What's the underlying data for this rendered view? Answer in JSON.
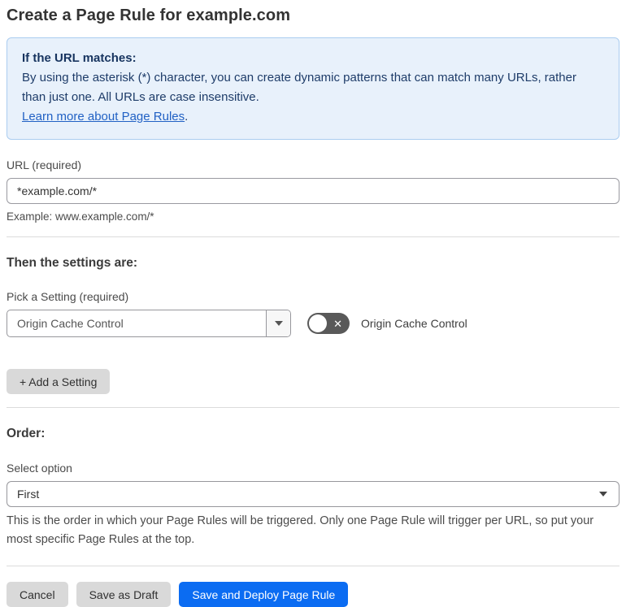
{
  "page": {
    "title": "Create a Page Rule for example.com"
  },
  "info_box": {
    "heading": "If the URL matches:",
    "body": "By using the asterisk (*) character, you can create dynamic patterns that can match many URLs, rather than just one. All URLs are case insensitive.",
    "link": "Learn more about Page Rules",
    "link_suffix": "."
  },
  "url_field": {
    "label": "URL (required)",
    "value": "*example.com/*",
    "example": "Example: www.example.com/*"
  },
  "settings": {
    "heading": "Then the settings are:",
    "pick_label": "Pick a Setting (required)",
    "selected_setting": "Origin Cache Control",
    "toggle_label": "Origin Cache Control",
    "toggle_state": "off",
    "toggle_glyph": "✕",
    "add_button": "+ Add a Setting"
  },
  "order": {
    "heading": "Order:",
    "select_label": "Select option",
    "selected_option": "First",
    "help": "This is the order in which your Page Rules will be triggered. Only one Page Rule will trigger per URL, so put your most specific Page Rules at the top."
  },
  "actions": {
    "cancel": "Cancel",
    "save_draft": "Save as Draft",
    "save_deploy": "Save and Deploy Page Rule"
  },
  "colors": {
    "accent_blue": "#0b6cf2",
    "info_bg": "#e8f1fb",
    "info_border": "#abcdf0",
    "info_text": "#1e3c69",
    "link_blue": "#2161c4",
    "toggle_off_bg": "#595959",
    "button_gray": "#d9d9d9"
  }
}
